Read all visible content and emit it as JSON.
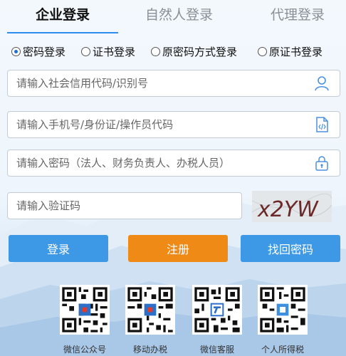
{
  "tabs": [
    {
      "label": "企业登录"
    },
    {
      "label": "自然人登录"
    },
    {
      "label": "代理登录"
    }
  ],
  "login_methods": [
    {
      "label": "密码登录",
      "checked": true
    },
    {
      "label": "证书登录",
      "checked": false
    },
    {
      "label": "原密码方式登录",
      "checked": false
    },
    {
      "label": "原证书登录",
      "checked": false
    }
  ],
  "fields": {
    "credit_code": {
      "placeholder": "请输入社会信用代码/识别号",
      "value": "",
      "icon": "user-icon"
    },
    "phone": {
      "placeholder": "请输入手机号/身份证/操作员代码",
      "value": "",
      "icon": "document-code-icon"
    },
    "password": {
      "placeholder": "请输入密码（法人、财务负责人、办税人员）",
      "value": "",
      "icon": "lock-icon"
    },
    "captcha": {
      "placeholder": "请输入验证码",
      "value": ""
    }
  },
  "captcha_text": "x2YW",
  "buttons": {
    "login": "登录",
    "register": "注册",
    "recover": "找回密码"
  },
  "qr_codes": [
    {
      "label": "微信公众号"
    },
    {
      "label": "移动办税"
    },
    {
      "label": "微信客服"
    },
    {
      "label": "个人所得税"
    }
  ],
  "colors": {
    "primary": "#3d98e6",
    "register": "#ef8a17",
    "tab_active_underline": "#2d8cf0"
  }
}
